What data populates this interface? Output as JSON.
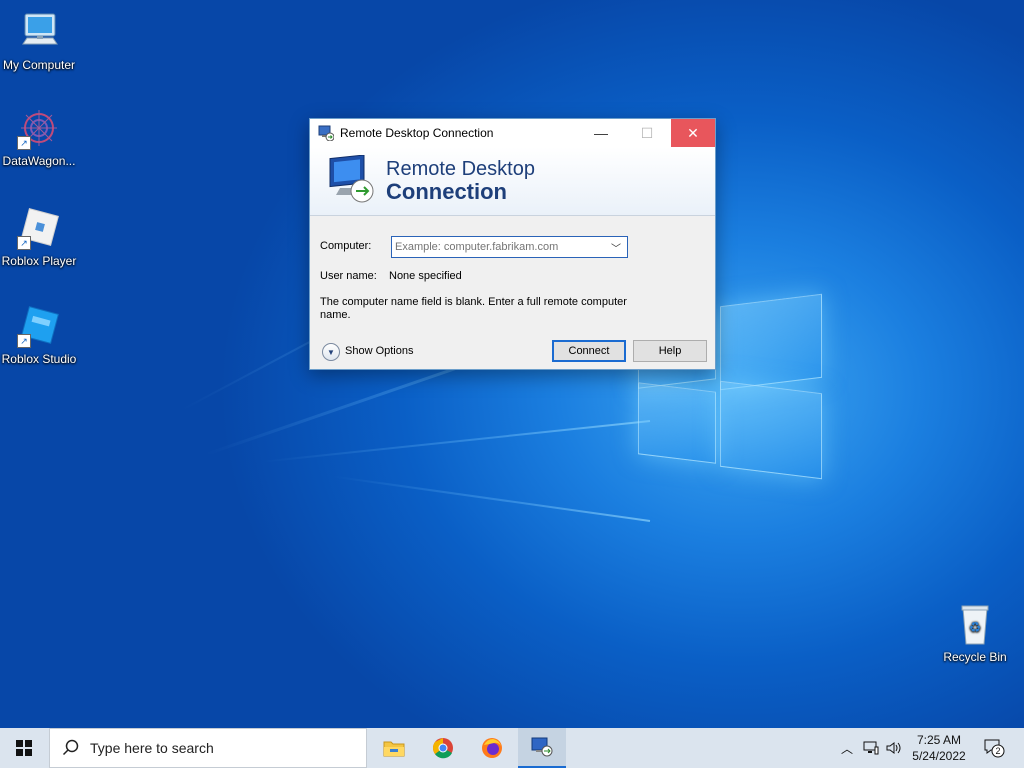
{
  "desktop": {
    "icons": [
      {
        "label": "My Computer",
        "icon": "computer-icon"
      },
      {
        "label": "DataWagon...",
        "icon": "datawagon-icon"
      },
      {
        "label": "Roblox Player",
        "icon": "roblox-player-icon"
      },
      {
        "label": "Roblox Studio",
        "icon": "roblox-studio-icon"
      },
      {
        "label": "Recycle Bin",
        "icon": "recycle-bin-icon"
      }
    ]
  },
  "dialog": {
    "title": "Remote Desktop Connection",
    "banner_line1": "Remote Desktop",
    "banner_line2": "Connection",
    "computer_label": "Computer:",
    "computer_value": "",
    "computer_placeholder": "Example: computer.fabrikam.com",
    "username_label": "User name:",
    "username_value": "None specified",
    "info_text": "The computer name field is blank. Enter a full remote computer name.",
    "show_options_label": "Show Options",
    "connect_label": "Connect",
    "help_label": "Help",
    "minimize_glyph": "—",
    "maximize_glyph": "☐",
    "close_glyph": "✕"
  },
  "taskbar": {
    "search_placeholder": "Type here to search",
    "pinned": [
      "file-explorer-icon",
      "chrome-icon",
      "firefox-icon",
      "remote-desktop-icon"
    ],
    "time": "7:25 AM",
    "date": "5/24/2022",
    "notification_count": "2"
  },
  "colors": {
    "desktop_blue": "#0a5fc6",
    "close_red": "#e8565c",
    "accent_blue": "#1a6bd1",
    "banner_text": "#1e3f7a"
  }
}
